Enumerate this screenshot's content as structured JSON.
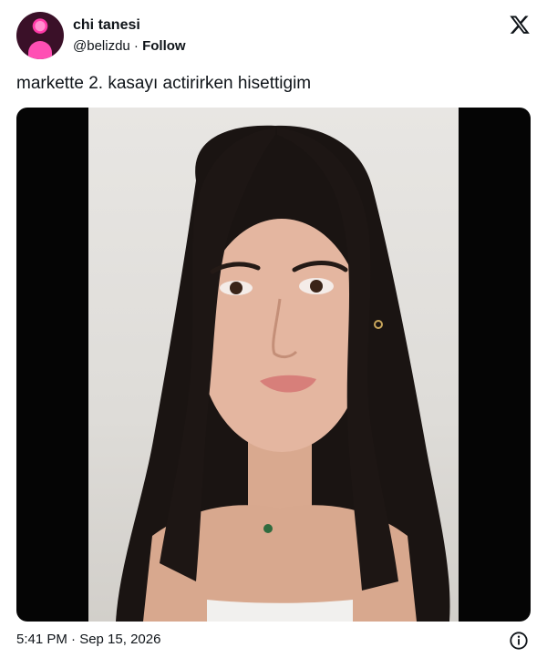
{
  "tweet": {
    "display_name": "chi tanesi",
    "handle": "@belizdu",
    "separator": " · ",
    "follow_label": "Follow",
    "text": "markette 2. kasayı actirirken hisettigim",
    "timestamp": "5:41 PM · Sep 15, 2026",
    "logo_icon": "x-logo-icon",
    "info_icon": "info-icon",
    "media_description_icon": "photo"
  }
}
